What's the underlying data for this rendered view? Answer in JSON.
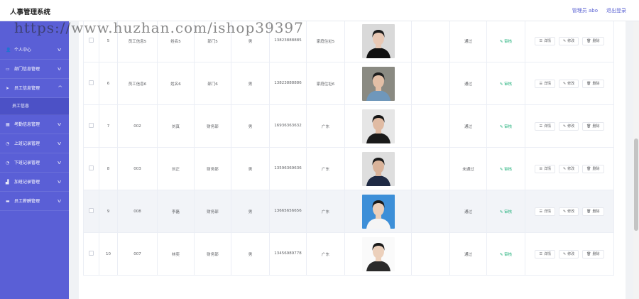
{
  "header": {
    "app_title": "人事管理系统",
    "user_label": "管理员 abo",
    "logout_label": "退出登录"
  },
  "watermark": "https://www.huzhan.com/ishop39397",
  "sidebar": {
    "items": [
      {
        "label": "个人中心",
        "icon": "user-icon",
        "expanded": false
      },
      {
        "label": "部门信息管理",
        "icon": "folder-icon",
        "expanded": false
      },
      {
        "label": "员工信息管理",
        "icon": "send-icon",
        "expanded": true,
        "children": [
          {
            "label": "员工信息"
          }
        ]
      },
      {
        "label": "考勤信息管理",
        "icon": "grid-icon",
        "expanded": false
      },
      {
        "label": "上班记录管理",
        "icon": "clock-icon",
        "expanded": false
      },
      {
        "label": "下班记录管理",
        "icon": "clock-icon",
        "expanded": false
      },
      {
        "label": "加班记录管理",
        "icon": "chart-icon",
        "expanded": false
      },
      {
        "label": "员工薪酬管理",
        "icon": "wallet-icon",
        "expanded": false
      }
    ]
  },
  "actions": {
    "audit_label": "审核",
    "detail_label": "详情",
    "edit_label": "修改",
    "delete_label": "删除"
  },
  "rows": [
    {
      "index": "5",
      "emp_no": "员工信息5",
      "name": "姓名5",
      "dept": "部门5",
      "gender": "男",
      "phone": "13823888885",
      "address": "家庭住址5",
      "status": "通过",
      "photo": {
        "skin": "#e8c8b4",
        "hair": "#1c1c1c",
        "cloth": "#111111",
        "bg": "#d9d9d9"
      }
    },
    {
      "index": "6",
      "emp_no": "员工信息6",
      "name": "姓名6",
      "dept": "部门6",
      "gender": "男",
      "phone": "13823888886",
      "address": "家庭住址6",
      "status": "通过",
      "photo": {
        "skin": "#e3bfa6",
        "hair": "#1e1e1e",
        "cloth": "#6f97bb",
        "bg": "#8a8a82"
      }
    },
    {
      "index": "7",
      "emp_no": "002",
      "name": "刘真",
      "dept": "财务部",
      "gender": "男",
      "phone": "16936363632",
      "address": "广东",
      "status": "通过",
      "photo": {
        "skin": "#e0bba3",
        "hair": "#161616",
        "cloth": "#1a1a1a",
        "bg": "#e6e6e6"
      }
    },
    {
      "index": "8",
      "emp_no": "003",
      "name": "刘正",
      "dept": "财务部",
      "gender": "男",
      "phone": "13596369636",
      "address": "广东",
      "status": "未通过",
      "photo": {
        "skin": "#d9b39a",
        "hair": "#1a1a1a",
        "cloth": "#1f2a44",
        "bg": "#dedede"
      }
    },
    {
      "index": "9",
      "emp_no": "008",
      "name": "李磊",
      "dept": "财务部",
      "gender": "男",
      "phone": "13665656656",
      "address": "广东",
      "status": "通过",
      "photo": {
        "skin": "#ecd0bb",
        "hair": "#1a1a1a",
        "cloth": "#f5f5f5",
        "bg": "#3d8fd8"
      }
    },
    {
      "index": "10",
      "emp_no": "007",
      "name": "林奕",
      "dept": "财务部",
      "gender": "男",
      "phone": "13456989778",
      "address": "广东",
      "status": "通过",
      "photo": {
        "skin": "#ecd0bb",
        "hair": "#1a1a1a",
        "cloth": "#2a2a2a",
        "bg": "#fafafa"
      }
    }
  ],
  "highlighted_row": 4
}
